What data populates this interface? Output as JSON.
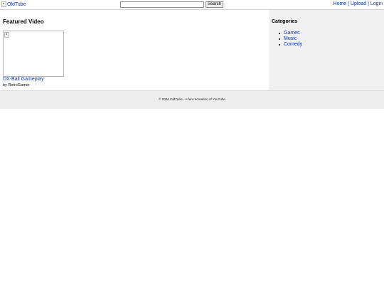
{
  "header": {
    "logo_alt": "OldTube",
    "search": {
      "value": "",
      "placeholder": "",
      "button_label": "Search"
    },
    "nav": {
      "home": "Home",
      "upload": "Upload",
      "login": "Login",
      "separator": "|"
    }
  },
  "main": {
    "featured_heading": "Featured Video",
    "video": {
      "title": "DX-Ball Gameplay",
      "author_line": "by RetroGamer"
    }
  },
  "sidebar": {
    "heading": "Categories",
    "items": [
      {
        "label": "Games"
      },
      {
        "label": "Music"
      },
      {
        "label": "Comedy"
      }
    ]
  },
  "footer": {
    "text": "© 2006 OldTube - A fan recreation of YouTube"
  },
  "colors": {
    "link": "#0033cc",
    "sidebar_bg": "#f1f1f1",
    "footer_bg": "#eeeeee"
  }
}
